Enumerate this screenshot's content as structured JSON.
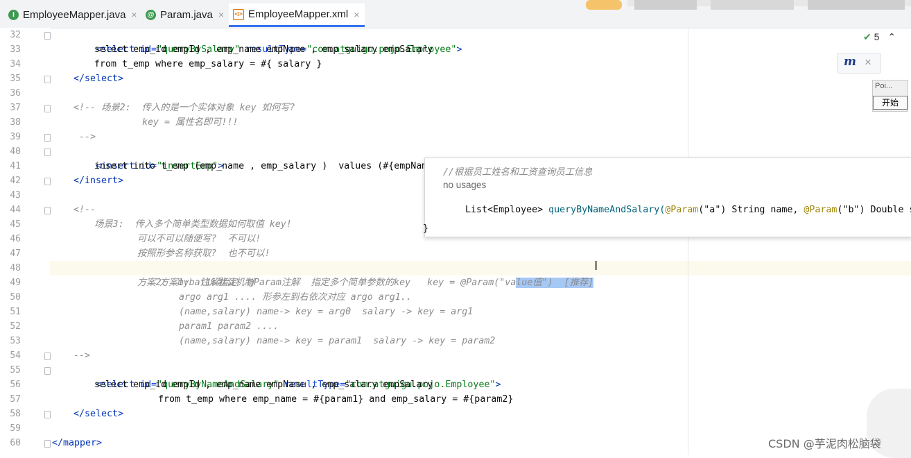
{
  "tabs": [
    {
      "label": "EmployeeMapper.java",
      "icon": "interface-icon",
      "icon_glyph": "I",
      "icon_color": "#3d9a50",
      "active": false
    },
    {
      "label": "Param.java",
      "icon": "annotation-icon",
      "icon_glyph": "@",
      "icon_color": "#3d9a50",
      "active": false
    },
    {
      "label": "EmployeeMapper.xml",
      "icon": "xml-file-icon",
      "icon_glyph": "</>",
      "icon_color": "#e06c00",
      "active": true
    }
  ],
  "tab_close_glyph": "×",
  "line_numbers": [
    "32",
    "33",
    "34",
    "35",
    "36",
    "37",
    "38",
    "39",
    "40",
    "41",
    "42",
    "43",
    "44",
    "45",
    "46",
    "47",
    "48",
    "49",
    "50",
    "51",
    "52",
    "53",
    "54",
    "55",
    "56",
    "57",
    "58",
    "59",
    "60"
  ],
  "code": {
    "l32": {
      "a": "<select ",
      "b": "id=",
      "c": "\"queryBySalary\"",
      "d": " resultType=",
      "e": "\"com.atguigu.pojo.Employee\"",
      "f": ">"
    },
    "l33": "select emp_id empId , emp_name empName , emp_salary empSalary",
    "l34": "from t_emp where emp_salary = #{ salary }",
    "l35": "</select>",
    "l37": "<!-- 场景2:  传入的是一个实体对象 key 如何写?",
    "l38": "key = 属性名即可!!!",
    "l39": "-->",
    "l40": {
      "a": "<insert ",
      "b": "id=",
      "c": "\"insertEmp\"",
      "d": ">"
    },
    "l41": "insert into t_emp (emp_name , emp_salary )  values (#{empName}",
    "l42": "</insert>",
    "l44": "<!--",
    "l45": "场景3:  传入多个简单类型数据如何取值 key!",
    "l46": "可以不可以随便写?  不可以!",
    "l47": "按照形参名称获取?  也不可以!",
    "l48a": "方案1:  注解指定  @Param注解  指定多个简单参数的key   key = @Param(\"va",
    "l48b": "lue值\")  [推荐]",
    "l49": "方案2:  mybatis默认机制",
    "l50": "argo arg1 .... 形参左到右依次对应 argo arg1..",
    "l51": "(name,salary) name-> key = arg0  salary -> key = arg1",
    "l52": "param1 param2 ....",
    "l53": "(name,salary) name-> key = param1  salary -> key = param2",
    "l54": "-->",
    "l55": {
      "a": "<select ",
      "b": "id=",
      "c": "\"queryByNameAndSalary\"",
      "d": " resultType=",
      "e": "\"com.atguigu.pojo.Employee\"",
      "f": ">"
    },
    "l56": "select emp_id empId , emp_name empName , emp_salary empSalary",
    "l57": "from t_emp where emp_name = #{param1} and emp_salary = #{param2}",
    "l58": "</select>",
    "l60": "</mapper>"
  },
  "popup": {
    "comment": "//根据员工姓名和工资查询员工信息",
    "usages": "no usages",
    "sig_a": "List<Employee> ",
    "sig_b": "queryByNameAndSalary(",
    "sig_c": "@Param",
    "sig_d": "(\"a\") String name, ",
    "sig_e": "@Param",
    "sig_f": "(\"b\") Double salary);",
    "brace": "}"
  },
  "inspections": {
    "count": "5",
    "check_glyph": "✔",
    "up_glyph": "⌃"
  },
  "mybatis_widget": {
    "glyph": "m",
    "close_glyph": "×"
  },
  "poi_widget": {
    "label": "Poi...",
    "button": "开始"
  },
  "watermark": "CSDN @芋泥肉松脑袋",
  "text_cursor_glyph": "I"
}
